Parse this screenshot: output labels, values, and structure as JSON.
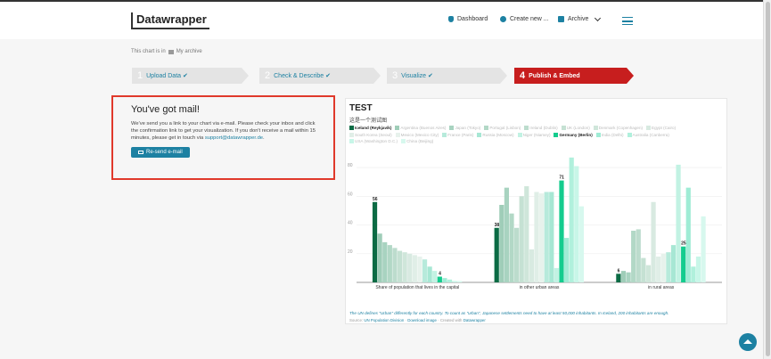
{
  "nav": {
    "logo": "Datawrapper",
    "dashboard": "Dashboard",
    "create_new": "Create new ...",
    "archive": "Archive"
  },
  "archive_note": {
    "prefix": "This chart is in",
    "folder": "My archive"
  },
  "steps": [
    {
      "num": "1",
      "label": "Upload Data ✔",
      "state": "done"
    },
    {
      "num": "2",
      "label": "Check & Describe ✔",
      "state": "done"
    },
    {
      "num": "3",
      "label": "Visualize ✔",
      "state": "done"
    },
    {
      "num": "4",
      "label": "Publish & Embed",
      "state": "active"
    }
  ],
  "mail": {
    "title": "You've got mail!",
    "text": "We've send you a link to your chart via e-mail. Please check your inbox and click the confirmation link to get your visualization. If you don't receive a mail within 15 minutes, please get in touch via ",
    "email": "support@datawrapper.de",
    "text_end": ".",
    "button": "Re-send e-mail"
  },
  "chart_card": {
    "notes": "The UN defines \"Urban\" differently for each country. To count as \"urban\", Japanese settlements need to have at least 50,000 inhabitants. In Iceland, 200 inhabitants are enough.",
    "source_label": "Source:",
    "source_link": "UN Population Division",
    "get_data": "Download image",
    "created_with": "Created with",
    "created_link": "Datawrapper"
  },
  "chart_data": {
    "type": "bar",
    "title": "TEST",
    "subtitle": "这是一个测试图",
    "ylim": [
      0,
      90
    ],
    "y_ticks": [
      20,
      40,
      60,
      80
    ],
    "grid": true,
    "categories": [
      "Share of population that lives in the capital",
      "in other urban areas",
      "in rural areas"
    ],
    "series": [
      {
        "name": "Iceland (Reykjavík)",
        "color": "#0b6b44",
        "values": [
          56,
          38,
          6
        ]
      },
      {
        "name": "Argentina (Buenos Aires)",
        "color": "#9fcdb8",
        "values": [
          34,
          54,
          8
        ]
      },
      {
        "name": "Japan (Tokyo)",
        "color": "#a8d3c0",
        "values": [
          28,
          66,
          7
        ]
      },
      {
        "name": "Portugal (Lisbon)",
        "color": "#b2d8c6",
        "values": [
          26,
          48,
          36
        ]
      },
      {
        "name": "Ireland (Dublin)",
        "color": "#bcdccd",
        "values": [
          24,
          38,
          37
        ]
      },
      {
        "name": "UK (London)",
        "color": "#c5e1d3",
        "values": [
          22,
          60,
          17
        ]
      },
      {
        "name": "Denmark (Copenhagen)",
        "color": "#cfe6da",
        "values": [
          21,
          67,
          12
        ]
      },
      {
        "name": "Egypt (Cairo)",
        "color": "#d8eae1",
        "values": [
          20,
          23,
          56
        ]
      },
      {
        "name": "South Korea (Seoul)",
        "color": "#e0eee7",
        "values": [
          19,
          63,
          18
        ]
      },
      {
        "name": "Mexico (Mexico City)",
        "color": "#e7f2ec",
        "values": [
          18,
          62,
          20
        ]
      },
      {
        "name": "France (Paris)",
        "color": "#b7eadb",
        "values": [
          16,
          63,
          21
        ]
      },
      {
        "name": "Russia (Moscow)",
        "color": "#a7e7d4",
        "values": [
          11,
          63,
          26
        ]
      },
      {
        "name": "Niger (Niamey)",
        "color": "#c2f2e3",
        "values": [
          8,
          10,
          82
        ]
      },
      {
        "name": "Germany (Berlin)",
        "color": "#14cc8e",
        "values": [
          4,
          71,
          25
        ]
      },
      {
        "name": "India (Delhi)",
        "color": "#9fecd5",
        "values": [
          3,
          31,
          66
        ]
      },
      {
        "name": "Australia (Canberra)",
        "color": "#b0f0dc",
        "values": [
          2,
          87,
          11
        ]
      },
      {
        "name": "USA (Washington D.C.)",
        "color": "#c8f6e8",
        "values": [
          1,
          81,
          18
        ]
      },
      {
        "name": "China (Beijing)",
        "color": "#d7f8ee",
        "values": [
          1,
          53,
          46
        ]
      }
    ],
    "labeled_values": [
      {
        "series": 0,
        "category": 0,
        "text": "56"
      },
      {
        "series": 13,
        "category": 0,
        "text": "4"
      },
      {
        "series": 0,
        "category": 1,
        "text": "38"
      },
      {
        "series": 13,
        "category": 1,
        "text": "71"
      },
      {
        "series": 0,
        "category": 2,
        "text": "6"
      },
      {
        "series": 13,
        "category": 2,
        "text": "25"
      }
    ]
  }
}
